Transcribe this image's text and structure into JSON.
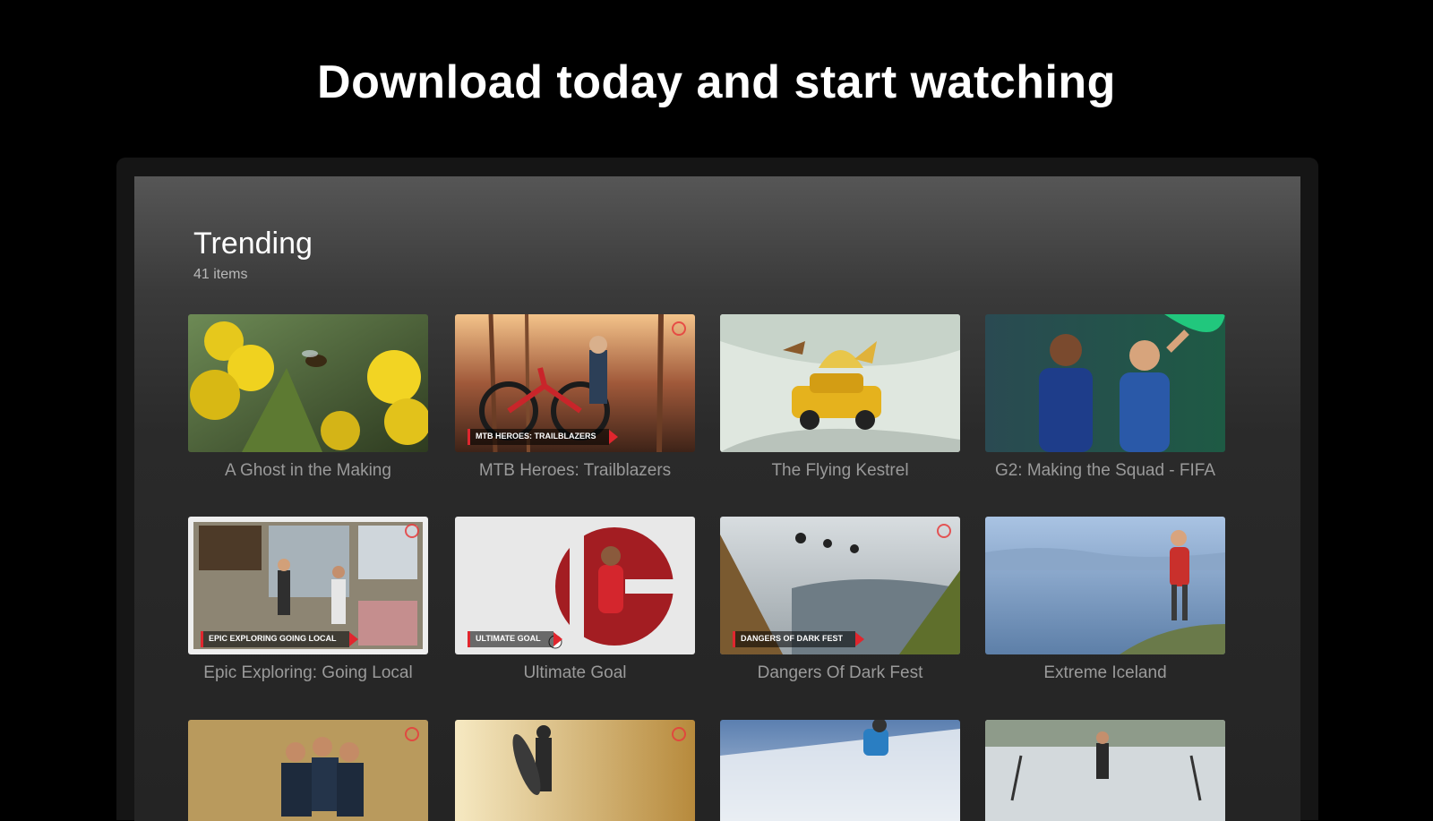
{
  "headline": "Download today and start watching",
  "section": {
    "title": "Trending",
    "count": "41 items"
  },
  "tiles": [
    {
      "title": "A Ghost in the Making",
      "badge": ""
    },
    {
      "title": "MTB Heroes: Trailblazers",
      "badge": "MTB HEROES: TRAILBLAZERS"
    },
    {
      "title": "The Flying Kestrel",
      "badge": ""
    },
    {
      "title": "G2: Making the Squad - FIFA",
      "badge": ""
    },
    {
      "title": "Epic Exploring: Going Local",
      "badge": "EPIC EXPLORING GOING LOCAL"
    },
    {
      "title": "Ultimate Goal",
      "badge": "ULTIMATE GOAL"
    },
    {
      "title": "Dangers Of Dark Fest",
      "badge": "DANGERS OF DARK FEST"
    },
    {
      "title": "Extreme Iceland",
      "badge": ""
    },
    {
      "title": "",
      "badge": ""
    },
    {
      "title": "",
      "badge": ""
    },
    {
      "title": "",
      "badge": ""
    },
    {
      "title": "",
      "badge": ""
    }
  ],
  "colors": {
    "accent": "#e0262e",
    "background": "#000000",
    "screen_top": "#565656",
    "screen_bottom": "#242424"
  }
}
